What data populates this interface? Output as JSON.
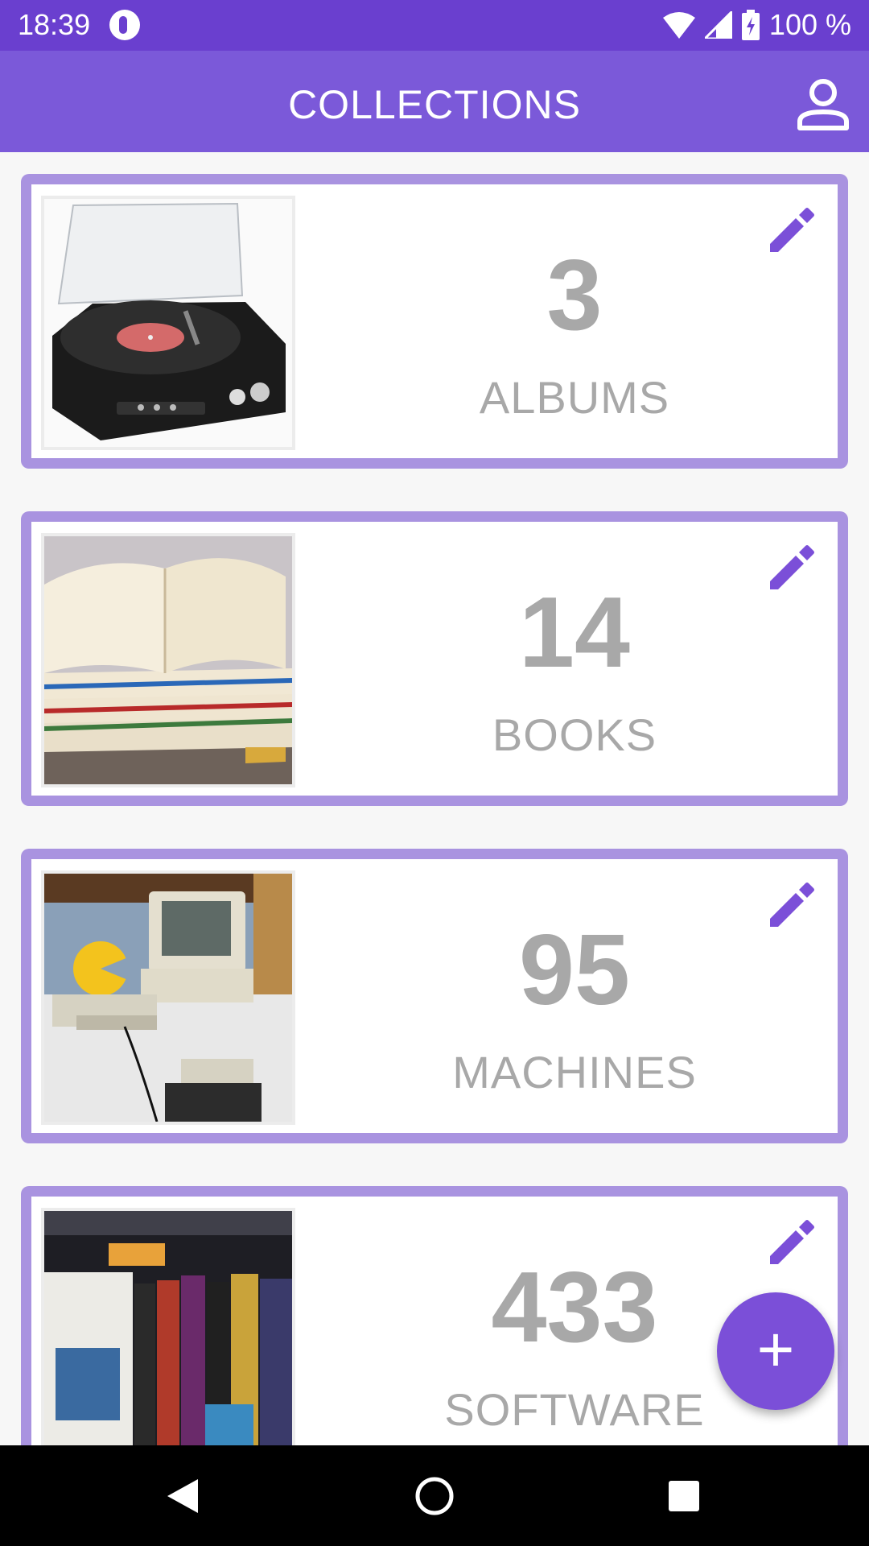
{
  "status_bar": {
    "time": "18:39",
    "app_notification_icon": "notification-app-icon",
    "wifi_icon": "wifi-icon",
    "signal_icon": "cell-signal-icon",
    "battery_icon": "battery-charging-icon",
    "battery_percent": "100 %"
  },
  "app_bar": {
    "title": "COLLECTIONS",
    "account_icon": "account-icon"
  },
  "collections": [
    {
      "count": "3",
      "label": "ALBUMS",
      "image": "record-player-photo"
    },
    {
      "count": "14",
      "label": "BOOKS",
      "image": "open-books-photo"
    },
    {
      "count": "95",
      "label": "MACHINES",
      "image": "retro-computers-photo"
    },
    {
      "count": "433",
      "label": "SOFTWARE",
      "image": "game-boxes-photo"
    }
  ],
  "fab": {
    "label": "+",
    "icon": "add-icon"
  },
  "nav_bar": {
    "back_icon": "back-icon",
    "home_icon": "home-icon",
    "recents_icon": "recents-icon"
  },
  "colors": {
    "status_bar": "#6a3fcf",
    "app_bar": "#7b59d9",
    "card_border": "#a993e0",
    "accent": "#7b4fd8",
    "count_text": "#a8a8a8"
  }
}
